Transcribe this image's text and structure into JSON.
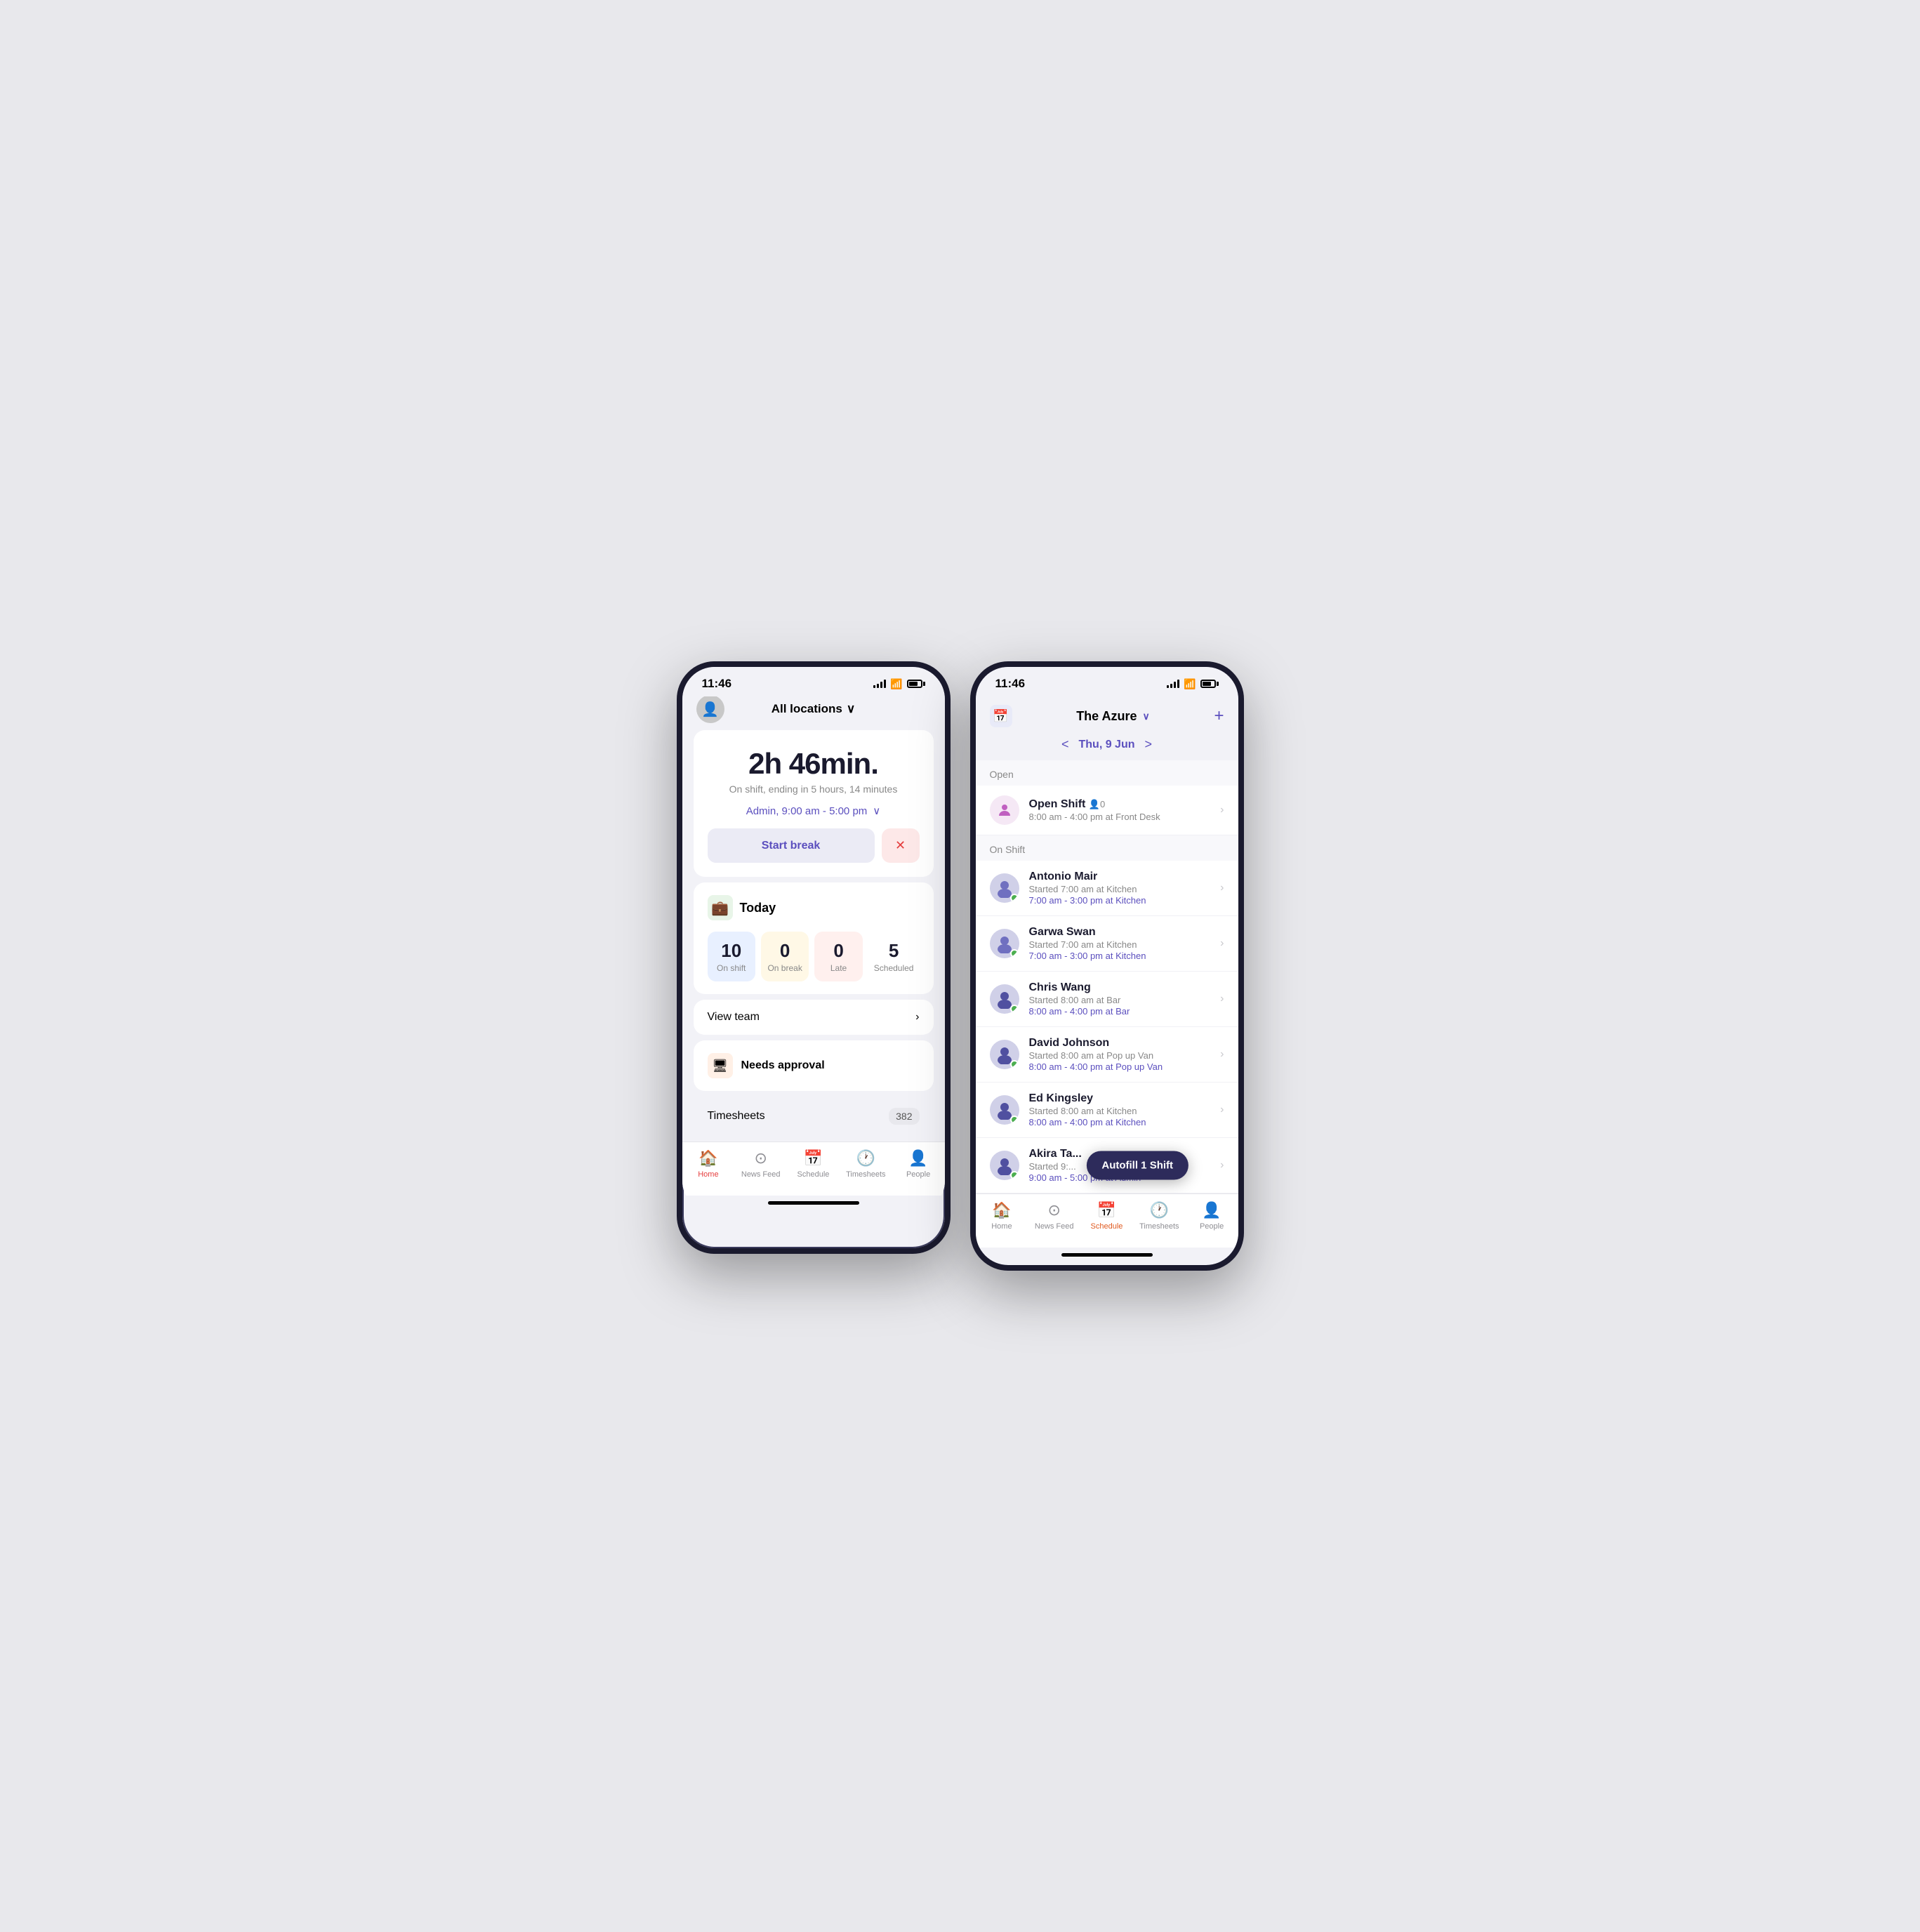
{
  "phone1": {
    "statusBar": {
      "time": "11:46",
      "hasLocation": true
    },
    "header": {
      "locationLabel": "All locations",
      "chevron": "∨"
    },
    "timer": {
      "display": "2h 46min.",
      "subtitle": "On shift, ending in 5 hours, 14 minutes",
      "shiftInfo": "Admin, 9:00 am - 5:00 pm",
      "startBreakLabel": "Start break",
      "endShiftIcon": "✕"
    },
    "today": {
      "title": "Today",
      "icon": "💼",
      "stats": [
        {
          "number": "10",
          "label": "On shift",
          "style": "blue"
        },
        {
          "number": "0",
          "label": "On break",
          "style": "yellow"
        },
        {
          "number": "0",
          "label": "Late",
          "style": "red"
        },
        {
          "number": "5",
          "label": "Scheduled",
          "style": "plain"
        }
      ],
      "viewTeamLabel": "View team"
    },
    "approval": {
      "icon": "🖥",
      "title": "Needs approval"
    },
    "timesheets": {
      "label": "Timesheets",
      "badge": "382"
    },
    "bottomNav": [
      {
        "id": "home",
        "icon": "🏠",
        "label": "Home",
        "active": true
      },
      {
        "id": "newsfeed",
        "icon": "◎",
        "label": "News Feed",
        "active": false
      },
      {
        "id": "schedule",
        "icon": "📅",
        "label": "Schedule",
        "active": false
      },
      {
        "id": "timesheets",
        "icon": "🕐",
        "label": "Timesheets",
        "active": false
      },
      {
        "id": "people",
        "icon": "👤",
        "label": "People",
        "active": false
      }
    ]
  },
  "phone2": {
    "statusBar": {
      "time": "11:46"
    },
    "header": {
      "locationLabel": "The Azure",
      "chevron": "∨",
      "addIcon": "+"
    },
    "dateNav": {
      "prev": "<",
      "next": ">",
      "date": "Thu, 9 Jun"
    },
    "sections": {
      "open": {
        "label": "Open",
        "shifts": [
          {
            "type": "open",
            "name": "Open Shift",
            "count": "👤0",
            "time": "8:00 am - 4:00 pm at Front Desk"
          }
        ]
      },
      "onShift": {
        "label": "On Shift",
        "shifts": [
          {
            "name": "Antonio Mair",
            "started": "Started 7:00 am at Kitchen",
            "time": "7:00 am - 3:00 pm at Kitchen"
          },
          {
            "name": "Garwa Swan",
            "started": "Started 7:00 am at Kitchen",
            "time": "7:00 am - 3:00 pm at Kitchen"
          },
          {
            "name": "Chris Wang",
            "started": "Started 8:00 am at Bar",
            "time": "8:00 am - 4:00 pm at Bar"
          },
          {
            "name": "David Johnson",
            "started": "Started 8:00 am at Pop up Van",
            "time": "8:00 am - 4:00 pm at Pop up Van"
          },
          {
            "name": "Ed Kingsley",
            "started": "Started 8:00 am at Kitchen",
            "time": "8:00 am - 4:00 pm at Kitchen"
          },
          {
            "name": "Akira Ta...",
            "started": "Started 9:...",
            "time": "9:00 am - 5:00 pm at Admin",
            "hasTooltip": true,
            "tooltipText": "Autofill 1 Shift"
          }
        ]
      }
    },
    "bottomNav": [
      {
        "id": "home",
        "icon": "🏠",
        "label": "Home",
        "active": false
      },
      {
        "id": "newsfeed",
        "icon": "◎",
        "label": "News Feed",
        "active": false
      },
      {
        "id": "schedule",
        "icon": "📅",
        "label": "Schedule",
        "active": true
      },
      {
        "id": "timesheets",
        "icon": "🕐",
        "label": "Timesheets",
        "active": false
      },
      {
        "id": "people",
        "icon": "👤",
        "label": "People",
        "active": false
      }
    ]
  }
}
